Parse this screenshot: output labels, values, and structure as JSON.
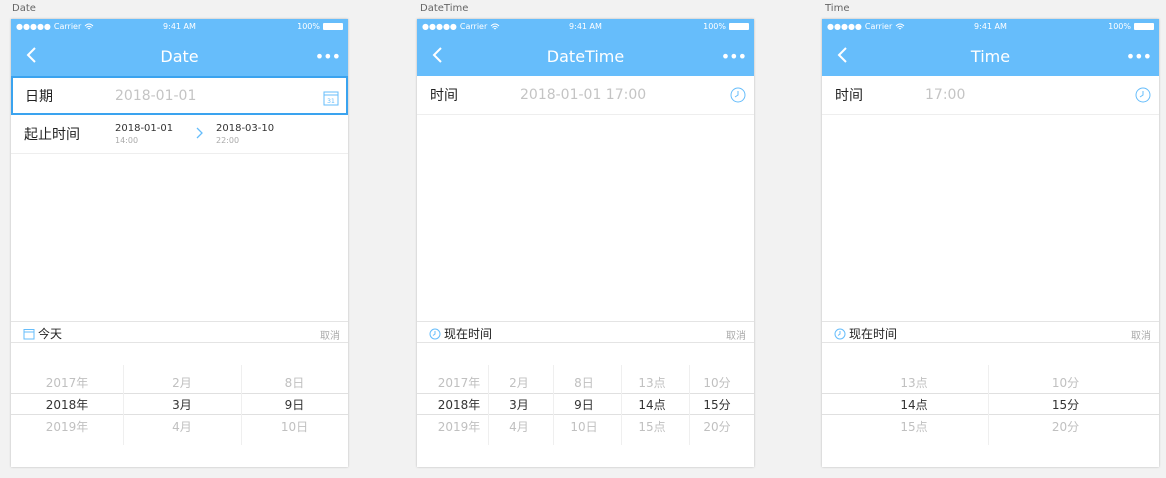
{
  "status": {
    "carrier": "Carrier",
    "time": "9:41 AM",
    "battery": "100%"
  },
  "screens": {
    "date": {
      "label": "Date",
      "title": "Date",
      "row1": {
        "label": "日期",
        "value": "2018-01-01"
      },
      "row2": {
        "label": "起止时间",
        "start_date": "2018-01-01",
        "start_time": "14:00",
        "end_date": "2018-03-10",
        "end_time": "22:00"
      },
      "toolbar": {
        "left": "今天",
        "cancel": "取消"
      },
      "columns": [
        [
          "2017年",
          "2018年",
          "2019年"
        ],
        [
          "2月",
          "3月",
          "4月"
        ],
        [
          "8日",
          "9日",
          "10日"
        ]
      ]
    },
    "datetime": {
      "label": "DateTime",
      "title": "DateTime",
      "row1": {
        "label": "时间",
        "value": "2018-01-01 17:00"
      },
      "toolbar": {
        "left": "现在时间",
        "cancel": "取消"
      },
      "columns": [
        [
          "2017年",
          "2018年",
          "2019年"
        ],
        [
          "2月",
          "3月",
          "4月"
        ],
        [
          "8日",
          "9日",
          "10日"
        ],
        [
          "13点",
          "14点",
          "15点"
        ],
        [
          "10分",
          "15分",
          "20分"
        ]
      ]
    },
    "time": {
      "label": "Time",
      "title": "Time",
      "row1": {
        "label": "时间",
        "value": "17:00"
      },
      "toolbar": {
        "left": "现在时间",
        "cancel": "取消"
      },
      "columns": [
        [
          "13点",
          "14点",
          "15点"
        ],
        [
          "10分",
          "15分",
          "20分"
        ]
      ]
    }
  },
  "colors": {
    "accent": "#66bdfb",
    "focus": "#3aa3ef"
  }
}
